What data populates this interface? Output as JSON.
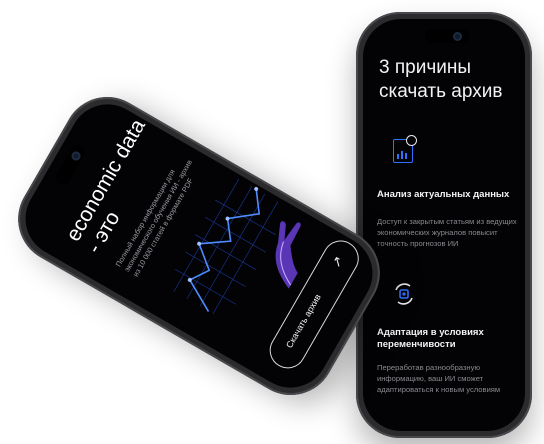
{
  "right_phone": {
    "title": "3 причины скачать архив",
    "features": [
      {
        "icon": "document-chart-search-icon",
        "title": "Анализ актуальных данных",
        "description": "Доступ к закрытым статьям из ведущих экономических журналов повысит точность прогнозов ИИ"
      },
      {
        "icon": "adaptation-cycle-icon",
        "title": "Адаптация в условиях переменчивости",
        "description": "Переработав разнообразную информацию, ваш ИИ сможет адаптироваться к новым условиям"
      }
    ]
  },
  "left_phone": {
    "title": "economic data - это",
    "description": "Полный набор информации для экономического обучения ИИ - архив из 10 000 статей в формате PDF",
    "button_label": "Скачать архив",
    "button_icon": "arrow-up-right-icon"
  },
  "colors": {
    "accent": "#2f72ff",
    "screen": "#030305",
    "frame": "#2b2b2e"
  }
}
